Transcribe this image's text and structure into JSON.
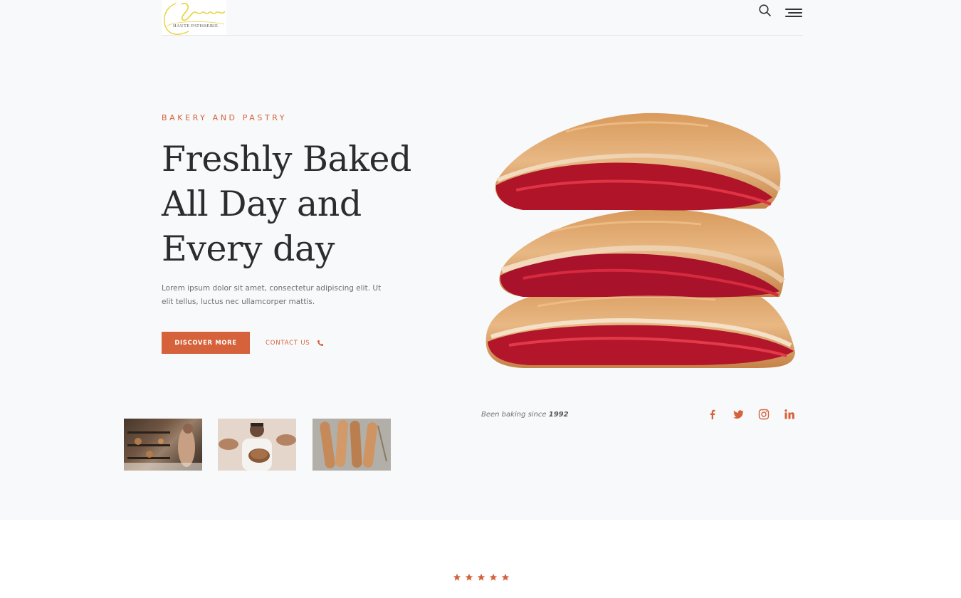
{
  "header": {
    "logo_script": "Yann",
    "logo_subtitle": "HAUTE PATISSERIE",
    "search_icon": "search-icon",
    "menu_icon": "hamburger-menu-icon"
  },
  "hero": {
    "eyebrow": "BAKERY AND PASTRY",
    "title_lines": [
      "Freshly Baked",
      "All Day and",
      "Every day"
    ],
    "description": "Lorem ipsum dolor sit amet, consectetur adipiscing elit. Ut elit tellus, luctus nec ullamcorper mattis.",
    "discover_label": "DISCOVER MORE",
    "contact_label": "CONTACT US",
    "contact_icon": "phone-icon",
    "image_icon": "stacked-pastry-image"
  },
  "since": {
    "prefix": "Been baking since",
    "year": "1992"
  },
  "social": [
    "facebook-icon",
    "twitter-icon",
    "instagram-icon",
    "linkedin-icon"
  ],
  "rating": {
    "stars": 5
  },
  "colors": {
    "accent": "#d5623b",
    "hero_background": "#f8f9fb",
    "text_dark": "#2c2c2c",
    "text_muted": "#6f6f6f"
  }
}
